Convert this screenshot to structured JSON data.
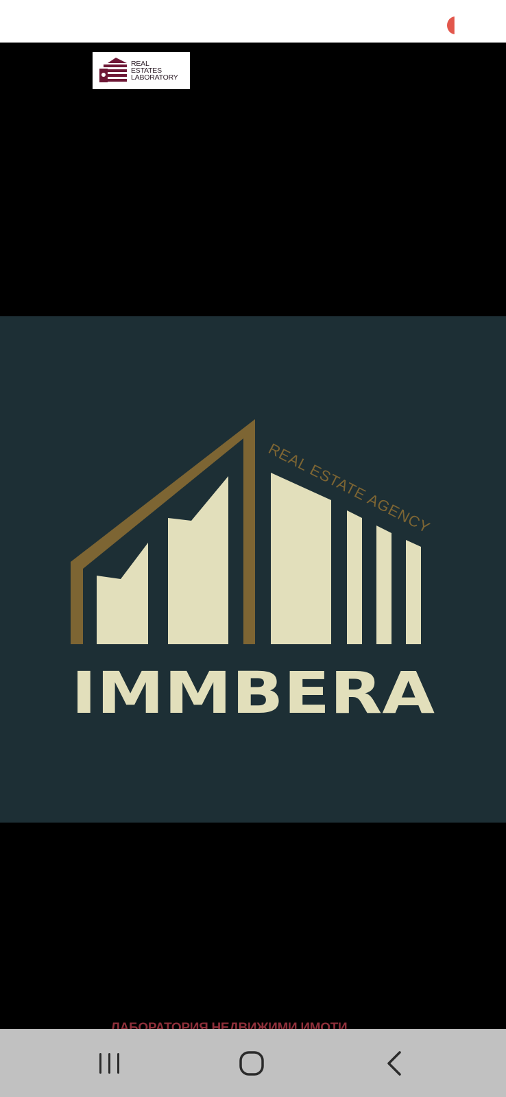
{
  "watermark": {
    "lines": [
      "REAL",
      "ESTATES",
      "LABORATORY"
    ]
  },
  "logo": {
    "tagline": "REAL ESTATE AGENCY",
    "brand": "IMMBERA",
    "colors": {
      "background": "#1d2f35",
      "gold": "#7d6533",
      "cream": "#e2dfbb"
    }
  },
  "caption": "ЛАБОРАТОРИЯ НЕДВИЖИМИ ИМОТИ",
  "navbar": {
    "recents_icon": "recents-icon",
    "home_icon": "home-icon",
    "back_icon": "back-icon"
  }
}
